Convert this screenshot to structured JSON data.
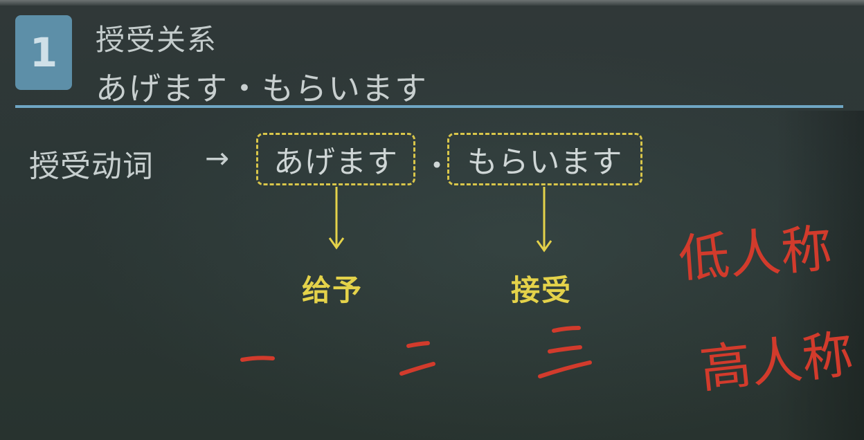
{
  "header": {
    "section_number": "1",
    "title_line1": "授受关系",
    "title_line2": "あげます・もらいます"
  },
  "main": {
    "term_label": "授受动词",
    "arrow": "→",
    "verb_give": "あげます",
    "separator": "・",
    "verb_receive": "もらいます",
    "meaning_give": "给予",
    "meaning_receive": "接受"
  },
  "handwriting": {
    "numbers": [
      "一",
      "二",
      "三"
    ],
    "note_top": "低人称",
    "note_bottom": "高人称"
  },
  "colors": {
    "board": "#2c3736",
    "badge": "#5d8fa8",
    "divider": "#6fa6c4",
    "highlight_yellow": "#e4d24a",
    "handwriting_red": "#d23b2c"
  },
  "icons": [
    "arrow-right-icon",
    "arrow-down-icon"
  ]
}
